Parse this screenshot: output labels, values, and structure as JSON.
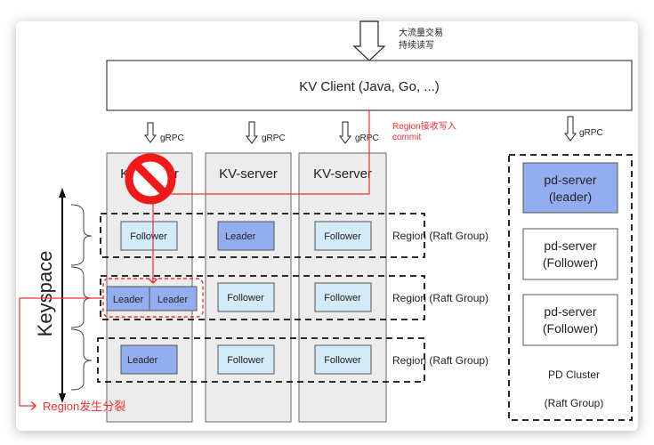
{
  "top_note": {
    "line1": "大流量交易",
    "line2": "持续读写"
  },
  "client": {
    "label": "KV Client (Java, Go, ...)"
  },
  "grpc_label": "gRPC",
  "red_note": {
    "line1": "Region接收写入",
    "line2": "commit"
  },
  "kv_servers": [
    {
      "label": "KV-server",
      "status": "unavailable"
    },
    {
      "label": "KV-server"
    },
    {
      "label": "KV-server"
    }
  ],
  "regions": [
    {
      "label": "Region (Raft Group)",
      "replicas": [
        "Follower",
        "Leader",
        "Follower"
      ]
    },
    {
      "label": "Region (Raft Group)",
      "replicas": [
        "Leader|Leader",
        "Follower",
        "Follower"
      ]
    },
    {
      "label": "Region (Raft Group)",
      "replicas": [
        "Leader",
        "Follower",
        "Follower"
      ]
    }
  ],
  "split": {
    "left": "Leader",
    "right": "Leader",
    "label": "Region发生分裂"
  },
  "keyspace_label": "Keyspace",
  "pd": {
    "servers": [
      {
        "line1": "pd-server",
        "line2": "(leader)",
        "role": "leader"
      },
      {
        "line1": "pd-server",
        "line2": "(Follower)",
        "role": "follower"
      },
      {
        "line1": "pd-server",
        "line2": "(Follower)",
        "role": "follower"
      }
    ],
    "cluster_line1": "PD Cluster",
    "cluster_line2": "(Raft Group)"
  },
  "colors": {
    "leader": "#93aef0",
    "follower": "#d3ebf8",
    "server_bg": "#ececec",
    "accent_red": "#f03030"
  }
}
